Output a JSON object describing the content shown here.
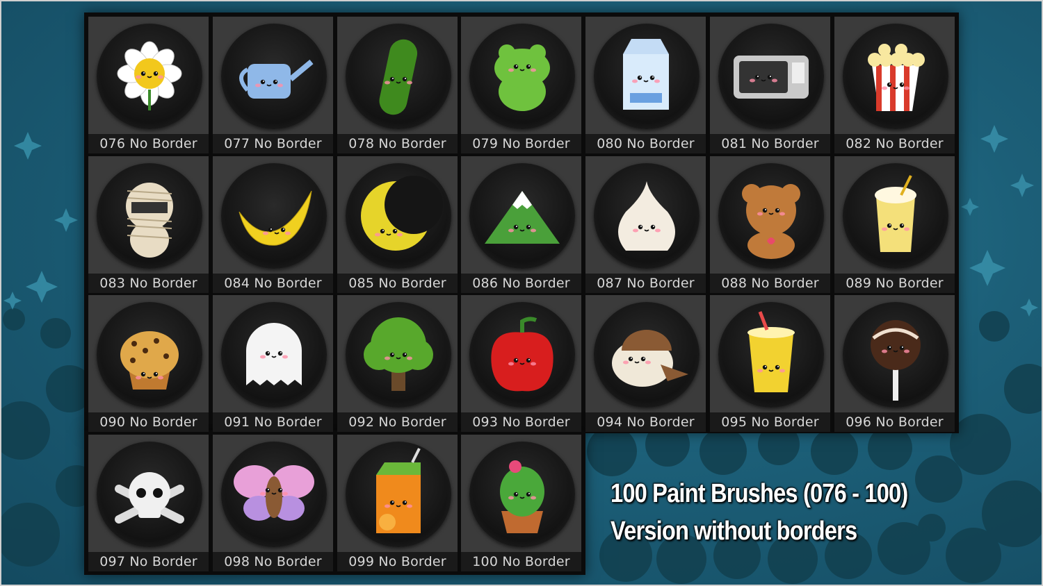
{
  "caption": {
    "line1": "100 Paint Brushes (076 - 100)",
    "line2": "Version without borders"
  },
  "tiles": [
    {
      "label": "076 No Border",
      "icon": "flower-icon",
      "color": "#f2c81c"
    },
    {
      "label": "077 No Border",
      "icon": "watering-can-icon",
      "color": "#8fb8e8"
    },
    {
      "label": "078 No Border",
      "icon": "cucumber-icon",
      "color": "#3f8a1e"
    },
    {
      "label": "079 No Border",
      "icon": "frog-icon",
      "color": "#6fc23e"
    },
    {
      "label": "080 No Border",
      "icon": "milk-carton-icon",
      "color": "#d9ebfb"
    },
    {
      "label": "081 No Border",
      "icon": "microwave-icon",
      "color": "#c9c9c9"
    },
    {
      "label": "082 No Border",
      "icon": "popcorn-icon",
      "color": "#d93a2b"
    },
    {
      "label": "083 No Border",
      "icon": "mummy-icon",
      "color": "#e8dcc4"
    },
    {
      "label": "084 No Border",
      "icon": "banana-icon",
      "color": "#f0d020"
    },
    {
      "label": "085 No Border",
      "icon": "crescent-moon-icon",
      "color": "#e6d42a"
    },
    {
      "label": "086 No Border",
      "icon": "mountain-icon",
      "color": "#4aa03a"
    },
    {
      "label": "087 No Border",
      "icon": "garlic-icon",
      "color": "#f3ece0"
    },
    {
      "label": "088 No Border",
      "icon": "teddy-bear-icon",
      "color": "#c07a3a"
    },
    {
      "label": "089 No Border",
      "icon": "banana-smoothie-icon",
      "color": "#f4e07a"
    },
    {
      "label": "090 No Border",
      "icon": "muffin-icon",
      "color": "#e0a84a"
    },
    {
      "label": "091 No Border",
      "icon": "ghost-icon",
      "color": "#f4f4f4"
    },
    {
      "label": "092 No Border",
      "icon": "tree-icon",
      "color": "#58a82c"
    },
    {
      "label": "093 No Border",
      "icon": "bell-pepper-icon",
      "color": "#d81e1e"
    },
    {
      "label": "094 No Border",
      "icon": "sparrow-icon",
      "color": "#8a5a34"
    },
    {
      "label": "095 No Border",
      "icon": "lemonade-cup-icon",
      "color": "#f2d230"
    },
    {
      "label": "096 No Border",
      "icon": "cake-pop-icon",
      "color": "#4a2a1a"
    },
    {
      "label": "097 No Border",
      "icon": "skull-crossbones-icon",
      "color": "#f0f0f0"
    },
    {
      "label": "098 No Border",
      "icon": "butterfly-icon",
      "color": "#e8a0d8"
    },
    {
      "label": "099 No Border",
      "icon": "juice-box-icon",
      "color": "#f08a1c"
    },
    {
      "label": "100 No Border",
      "icon": "potted-cactus-icon",
      "color": "#4aa83a"
    }
  ]
}
